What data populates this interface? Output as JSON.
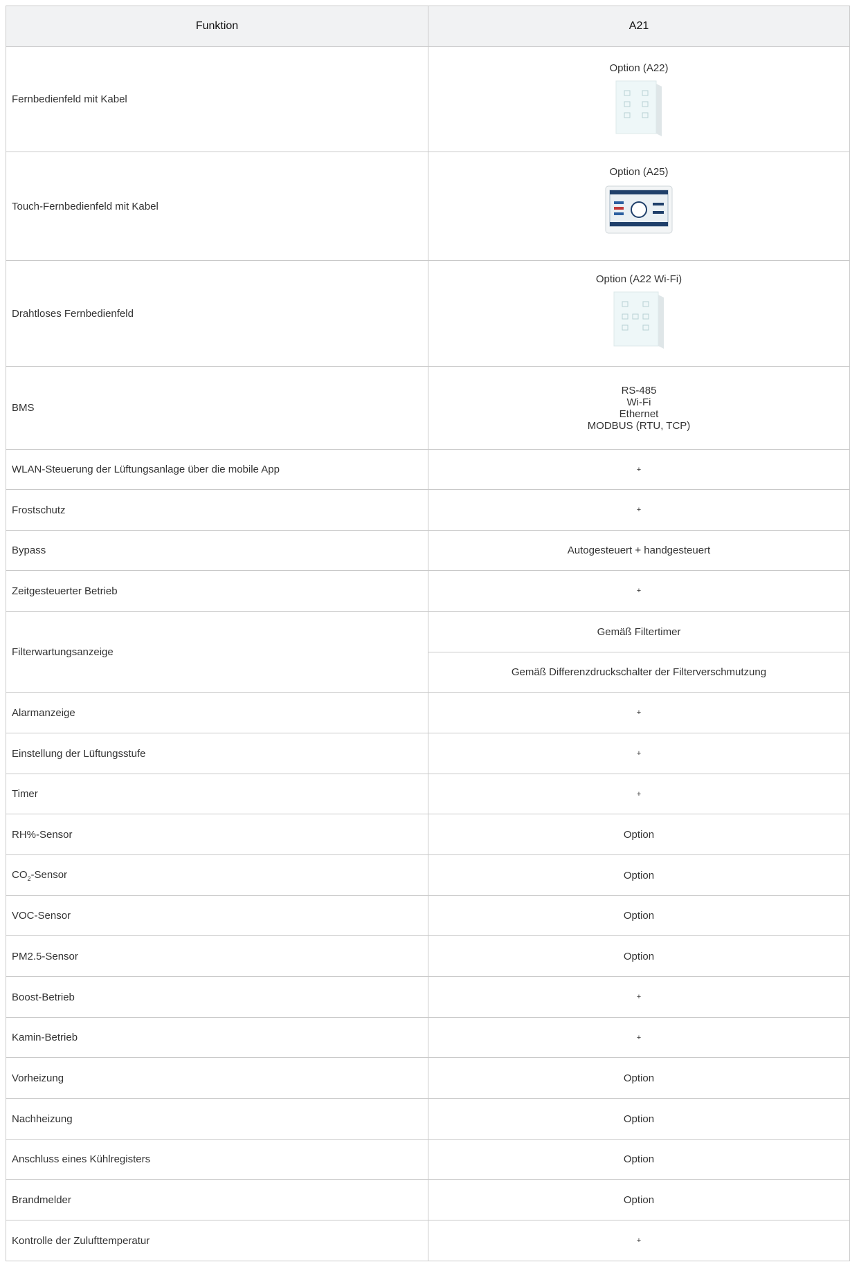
{
  "header": {
    "col1": "Funktion",
    "col2": "A21"
  },
  "rows": [
    {
      "label": "Fernbedienfeld mit Kabel",
      "value": "Option (A22)",
      "image": "wall-panel-6-button"
    },
    {
      "label": "Touch-Fernbedienfeld mit Kabel",
      "value": "Option (A25)",
      "image": "touch-screen-panel"
    },
    {
      "label": "Drahtloses Fernbedienfeld",
      "value": "Option (A22 Wi-Fi)",
      "image": "wall-panel-7-button"
    },
    {
      "label": "BMS",
      "lines": [
        "RS-485",
        "Wi-Fi",
        "Ethernet",
        "MODBUS (RTU, TCP)"
      ]
    },
    {
      "label": "WLAN-Steuerung der Lüftungsanlage über die mobile App",
      "value": "+"
    },
    {
      "label": "Frostschutz",
      "value": "+"
    },
    {
      "label": "Bypass",
      "value": "Autogesteuert + handgesteuert"
    },
    {
      "label": "Zeitgesteuerter Betrieb",
      "value": "+"
    },
    {
      "label": "Filterwartungsanzeige",
      "values": [
        "Gemäß Filtertimer",
        "Gemäß Differenzdruckschalter der Filterverschmutzung"
      ]
    },
    {
      "label": "Alarmanzeige",
      "value": "+"
    },
    {
      "label": "Einstellung der Lüftungsstufe",
      "value": "+"
    },
    {
      "label": "Timer",
      "value": "+"
    },
    {
      "label": "RH%-Sensor",
      "value": "Option"
    },
    {
      "label_main": "CO",
      "label_sub": "2",
      "label_rest": "-Sensor",
      "value": "Option"
    },
    {
      "label": "VOC-Sensor",
      "value": "Option"
    },
    {
      "label": "PM2.5-Sensor",
      "value": "Option"
    },
    {
      "label": "Boost-Betrieb",
      "value": "+"
    },
    {
      "label": "Kamin-Betrieb",
      "value": "+"
    },
    {
      "label": "Vorheizung",
      "value": "Option"
    },
    {
      "label": "Nachheizung",
      "value": "Option"
    },
    {
      "label": "Anschluss eines Kühlregisters",
      "value": "Option"
    },
    {
      "label": "Brandmelder",
      "value": "Option"
    },
    {
      "label": "Kontrolle der Zulufttemperatur",
      "value": "+"
    }
  ]
}
